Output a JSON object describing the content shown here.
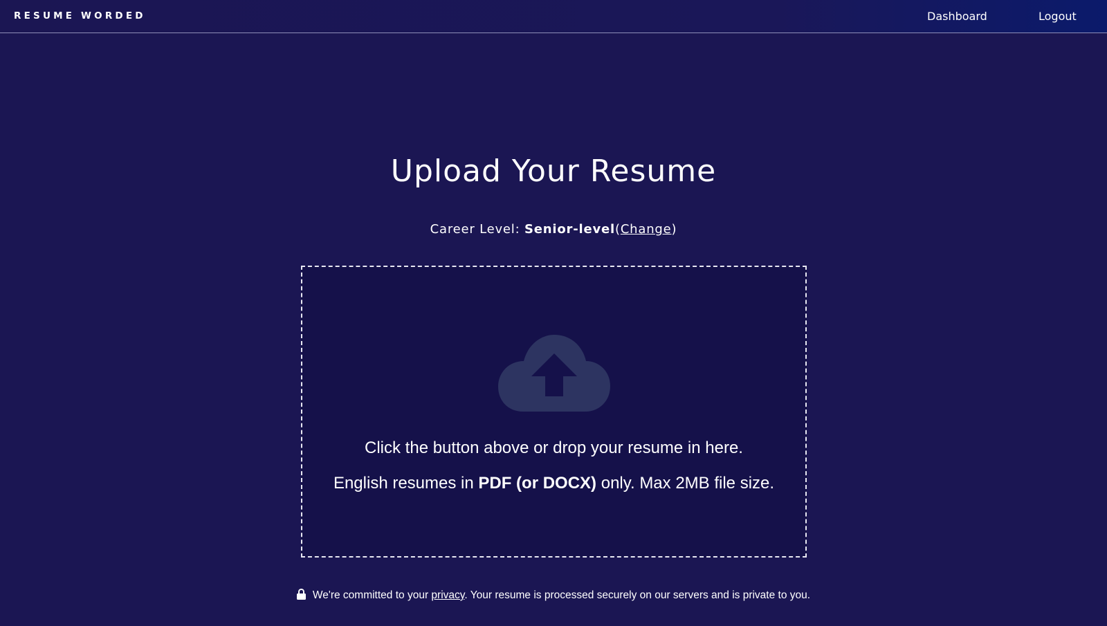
{
  "nav": {
    "logo": "RESUME WORDED",
    "links": [
      {
        "label": "Dashboard"
      },
      {
        "label": "Logout"
      }
    ]
  },
  "main": {
    "title": "Upload Your Resume",
    "career_label": "Career Level:",
    "career_value": "Senior-level",
    "career_change_open": "(",
    "career_change_link": "Change",
    "career_change_close": ")"
  },
  "dropzone": {
    "icon": "cloud-upload-icon",
    "line1": "Click the button above or drop your resume in here.",
    "line2_prefix": "English resumes in",
    "line2_bold": "PDF (or DOCX)",
    "line2_suffix": "only. Max 2MB file size."
  },
  "privacy": {
    "icon": "lock-icon",
    "prefix": "We're committed to your",
    "link": "privacy",
    "suffix": ". Your resume is processed securely on our servers and is private to you."
  },
  "colors": {
    "background": "#1b1653",
    "dropzone_bg": "#15114a",
    "icon": "#2d3461",
    "text": "#ffffff"
  }
}
